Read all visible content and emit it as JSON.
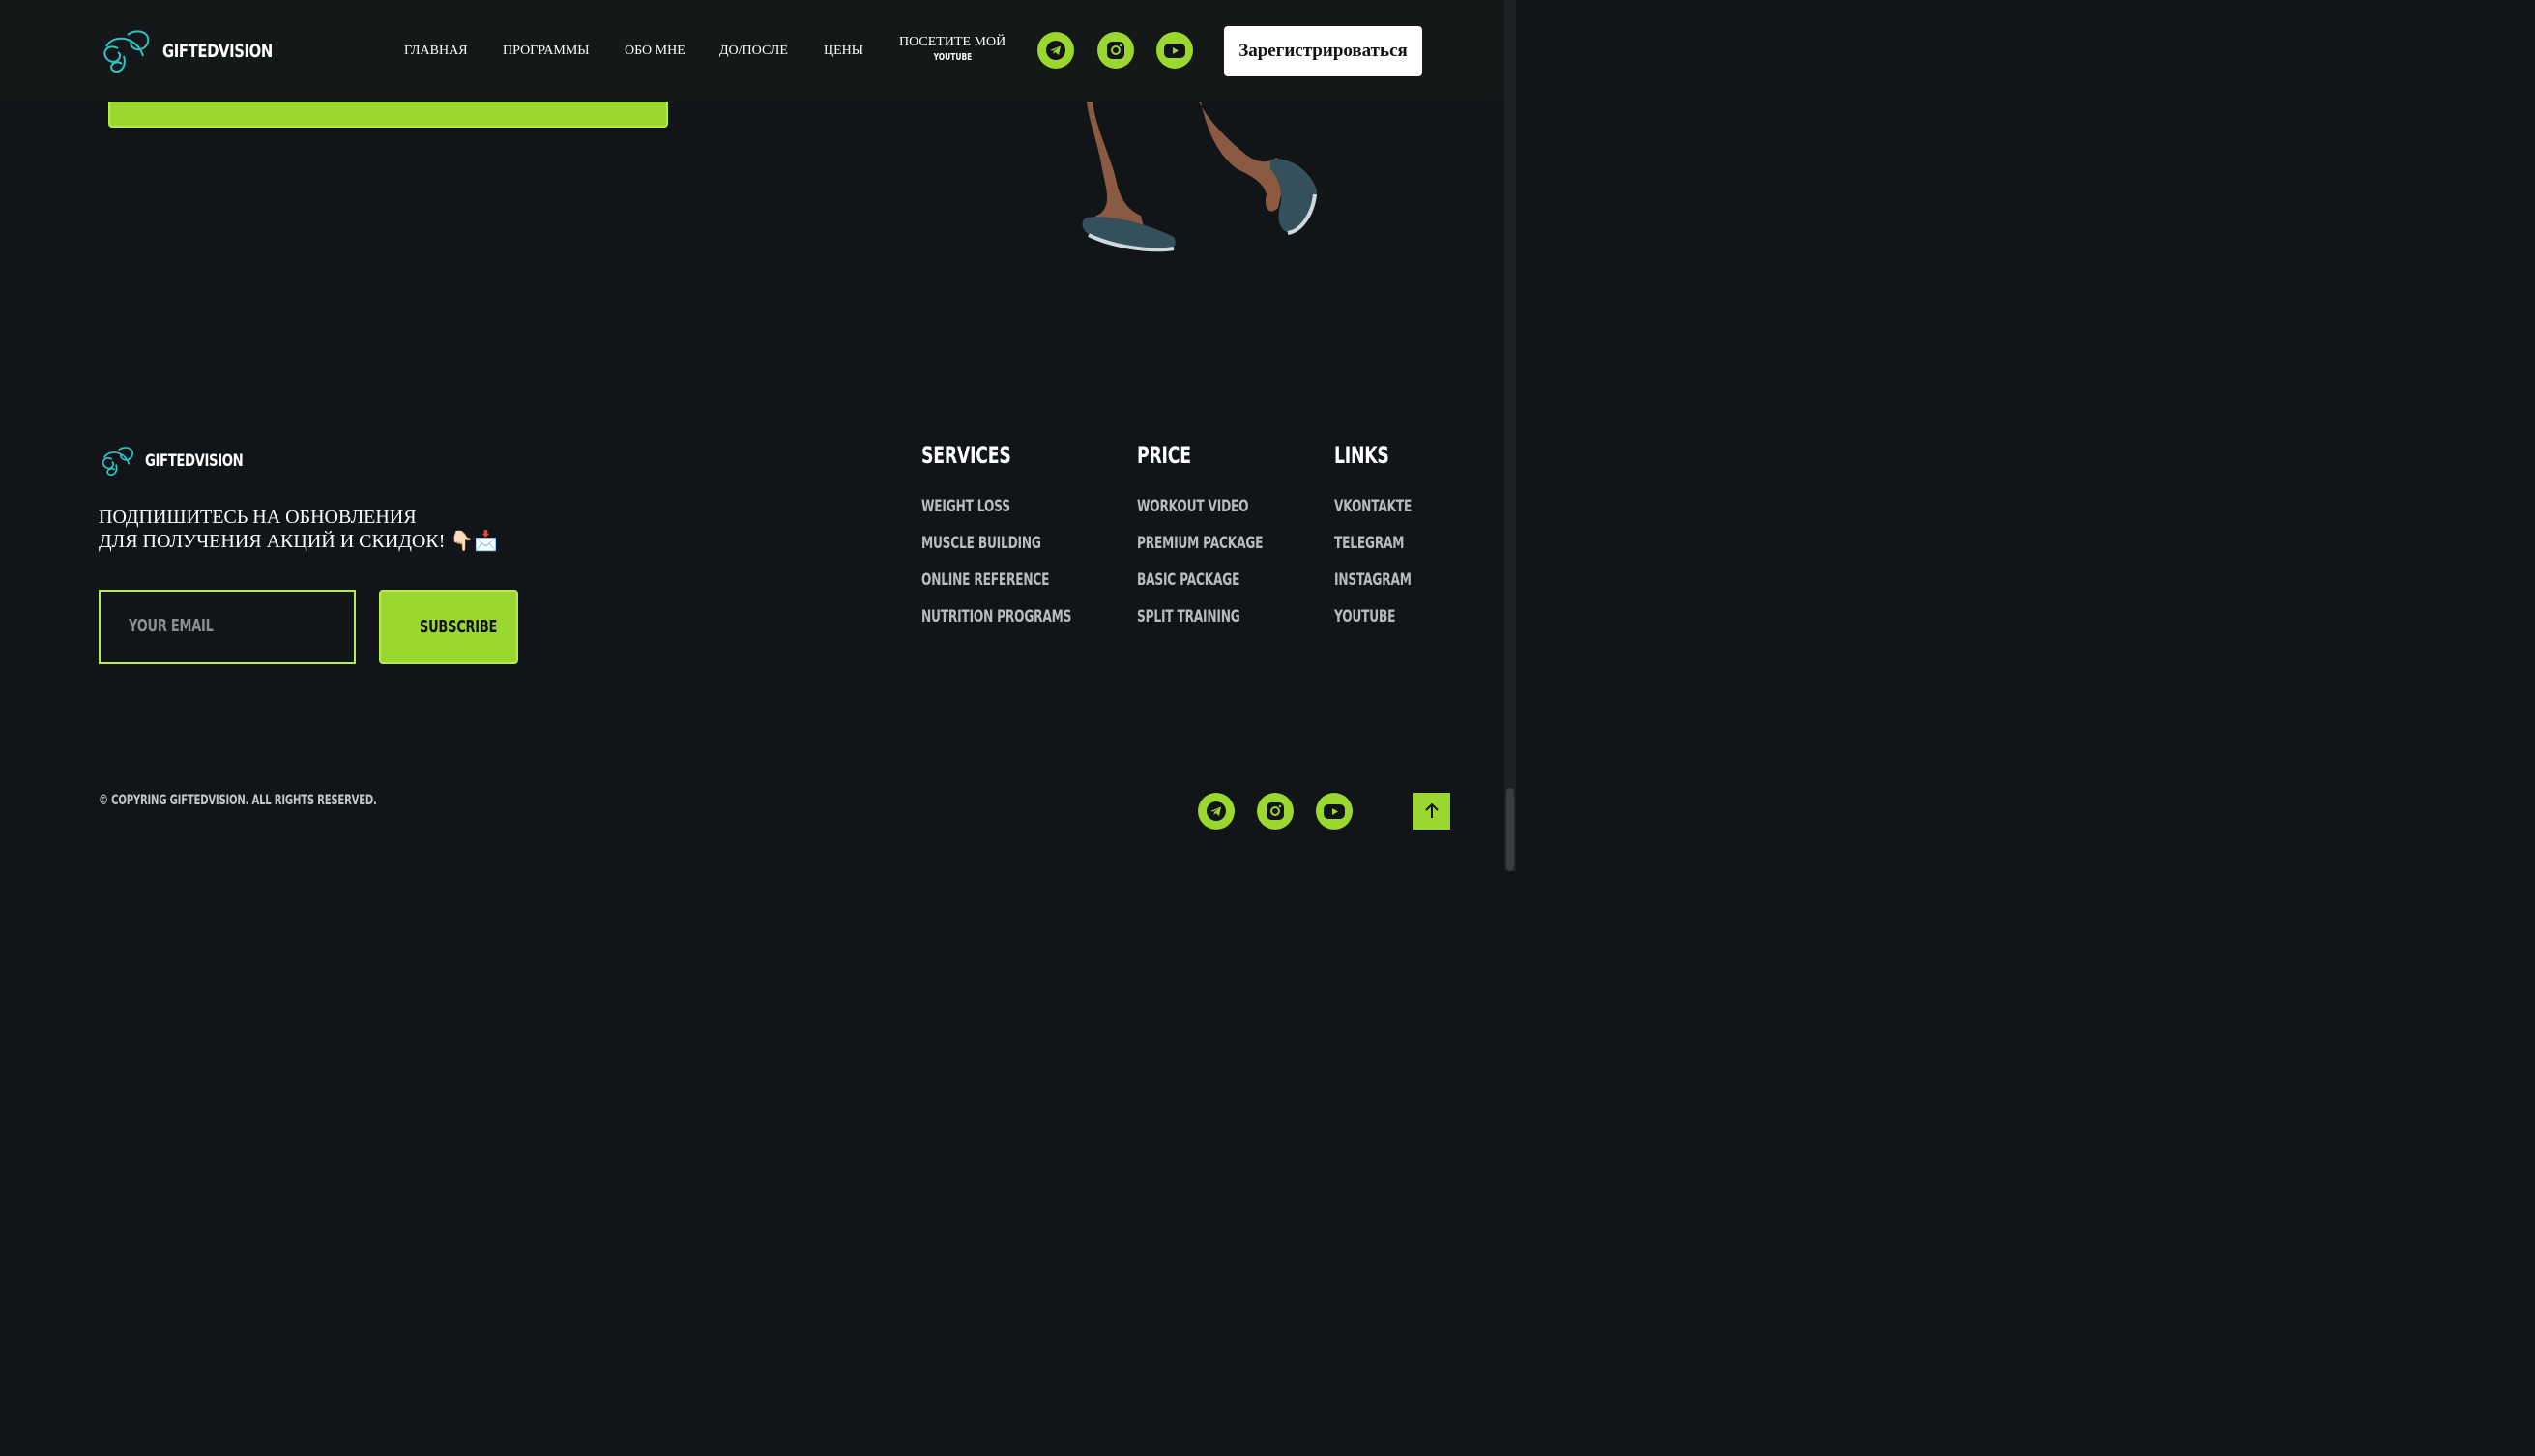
{
  "brand": {
    "name": "GIFTEDVISION",
    "accent": "#9bd82f",
    "logo_color": "#2ec4c4"
  },
  "header": {
    "nav": [
      "ГЛАВНАЯ",
      "ПРОГРАММЫ",
      "ОБО МНЕ",
      "ДО/ПОСЛЕ",
      "ЦЕНЫ"
    ],
    "youtube_line1": "ПОСЕТИТЕ МОЙ",
    "youtube_line2": "YOUTUBE",
    "socials": [
      "telegram-icon",
      "instagram-icon",
      "youtube-icon"
    ],
    "register_label": "Зарегистрироваться"
  },
  "footer": {
    "subscribe_line1": "ПОДПИШИТЕСЬ НА ОБНОВЛЕНИЯ",
    "subscribe_line2": "ДЛЯ ПОЛУЧЕНИЯ АКЦИЙ И СКИДОК! 👇🏻📩",
    "email_placeholder": "YOUR EMAIL",
    "subscribe_label": "SUBSCRIBE",
    "columns": [
      {
        "title": "SERVICES",
        "links": [
          "WEIGHT LOSS",
          "MUSCLE BUILDING",
          "ONLINE REFERENCE",
          "NUTRITION PROGRAMS"
        ]
      },
      {
        "title": "PRICE",
        "links": [
          "WORKOUT VIDEO",
          "PREMIUM PACKAGE",
          "BASIC PACKAGE",
          "SPLIT TRAINING"
        ]
      },
      {
        "title": "LINKS",
        "links": [
          "VKONTAKTE",
          "TELEGRAM",
          "INSTAGRAM",
          "YOUTUBE"
        ]
      }
    ],
    "copyright": "© COPYRING GIFTEDVISION. ALL RIGHTS RESERVED.",
    "socials": [
      "telegram-icon",
      "instagram-icon",
      "youtube-icon"
    ],
    "back_to_top_icon": "arrow-up-icon"
  }
}
